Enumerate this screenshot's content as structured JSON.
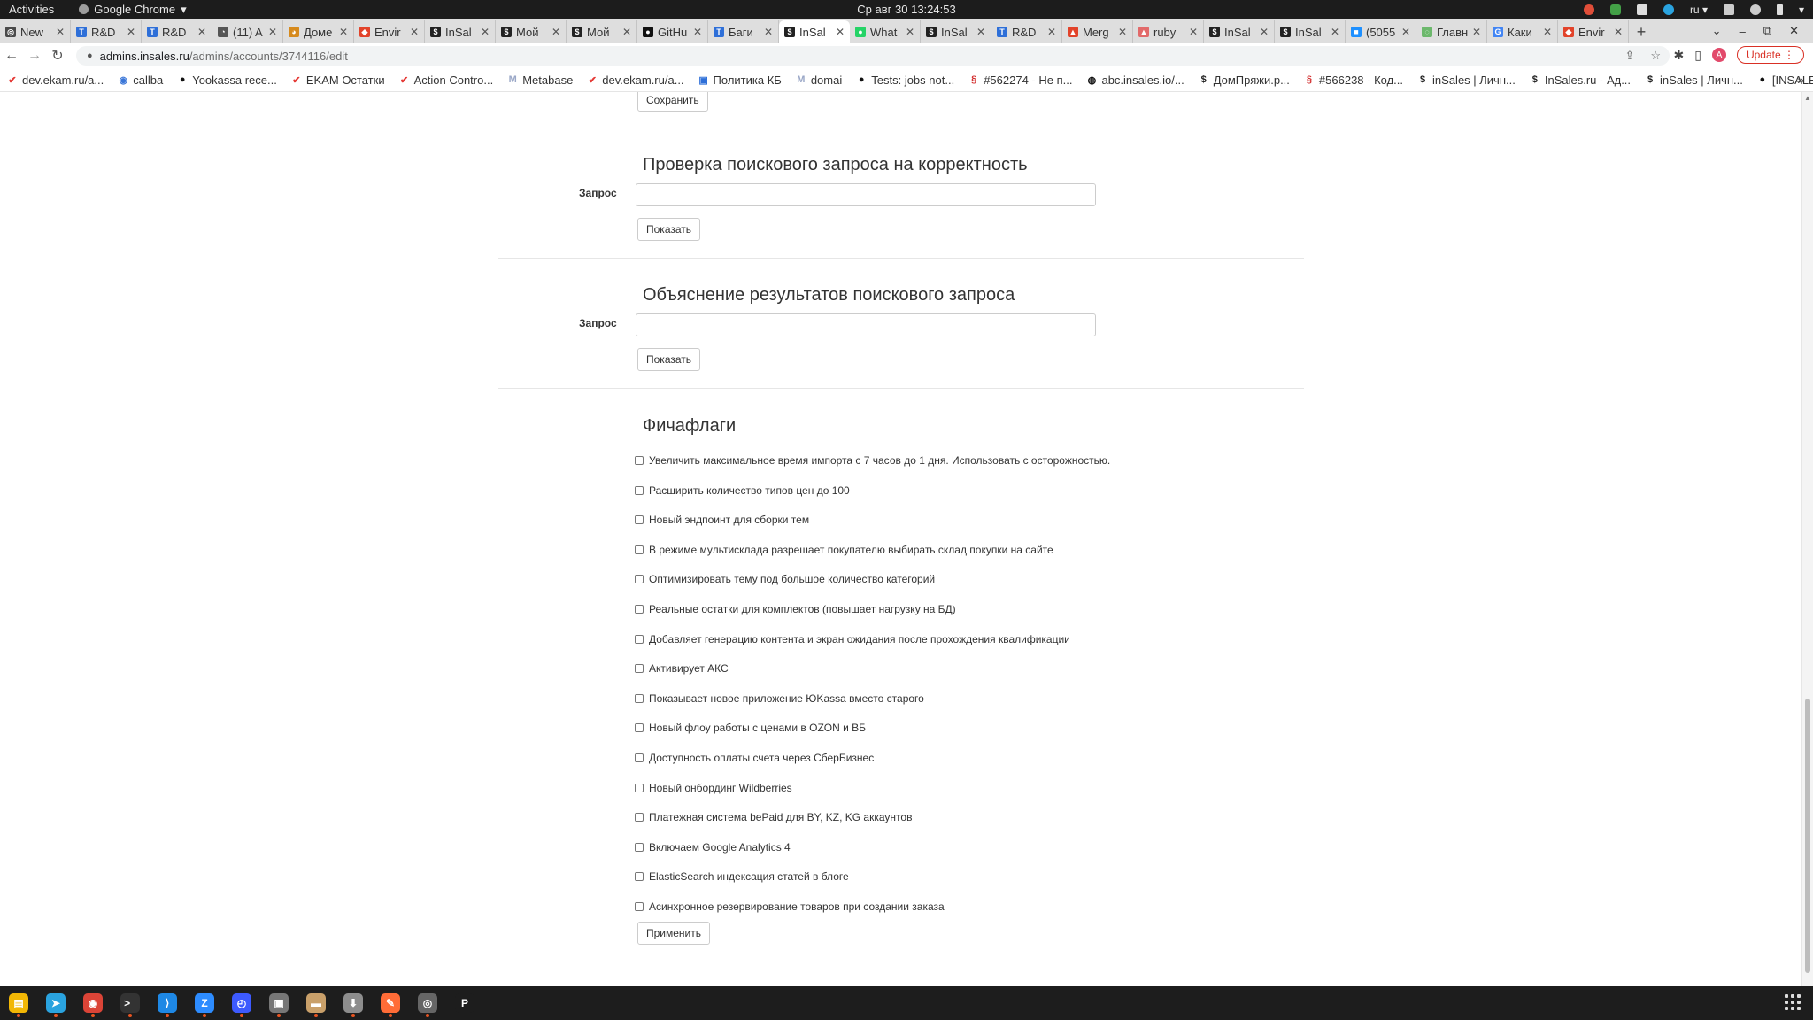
{
  "system": {
    "activities": "Activities",
    "app_name": "Google Chrome",
    "app_menu_arrow": "▾",
    "clock": "Ср авг 30  13:24:53",
    "lang": "ru ▾"
  },
  "tabs": [
    {
      "title": "New",
      "color": "#4a4a4a",
      "glyph": "◎"
    },
    {
      "title": "R&D",
      "color": "#2e6fd8",
      "glyph": "T"
    },
    {
      "title": "R&D",
      "color": "#2e6fd8",
      "glyph": "T"
    },
    {
      "title": "(11) A",
      "color": "#555555",
      "glyph": "◔"
    },
    {
      "title": "Доме",
      "color": "#d68a1d",
      "glyph": "◕"
    },
    {
      "title": "Envir",
      "color": "#e2432a",
      "glyph": "◆"
    },
    {
      "title": "InSal",
      "color": "#222222",
      "glyph": "$"
    },
    {
      "title": "Мой",
      "color": "#222222",
      "glyph": "$"
    },
    {
      "title": "Мой",
      "color": "#222222",
      "glyph": "$"
    },
    {
      "title": "GitHu",
      "color": "#111111",
      "glyph": "●"
    },
    {
      "title": "Баги",
      "color": "#2e6fd8",
      "glyph": "T"
    },
    {
      "title": "InSal",
      "color": "#222222",
      "glyph": "$",
      "active": true
    },
    {
      "title": "What",
      "color": "#25d366",
      "glyph": "●"
    },
    {
      "title": "InSal",
      "color": "#222222",
      "glyph": "$"
    },
    {
      "title": "R&D",
      "color": "#2e6fd8",
      "glyph": "T"
    },
    {
      "title": "Merg",
      "color": "#e2432a",
      "glyph": "▲"
    },
    {
      "title": "ruby",
      "color": "#e26a6a",
      "glyph": "▲"
    },
    {
      "title": "InSal",
      "color": "#222222",
      "glyph": "$"
    },
    {
      "title": "InSal",
      "color": "#222222",
      "glyph": "$"
    },
    {
      "title": "(5055",
      "color": "#1e90ff",
      "glyph": "■"
    },
    {
      "title": "Главн",
      "color": "#6cb86c",
      "glyph": "◌"
    },
    {
      "title": "Каки",
      "color": "#4285f4",
      "glyph": "G"
    },
    {
      "title": "Envir",
      "color": "#e2432a",
      "glyph": "◆"
    }
  ],
  "tab_close": "✕",
  "new_tab": "+",
  "tabstrip_controls": {
    "list": "⌄",
    "minimize": "–",
    "restore": "⧉",
    "close": "✕"
  },
  "toolbar": {
    "back": "←",
    "forward": "→",
    "reload": "↻",
    "lock": "🔒",
    "url_domain": "admins.insales.ru",
    "url_path": "/admins/accounts/3744116/edit",
    "share": "⇪",
    "star": "☆",
    "extensions": "✱",
    "sidepanel": "▯",
    "profile": "A",
    "update": "Update",
    "menu": "⋮"
  },
  "bookmarks": [
    {
      "label": "dev.ekam.ru/a...",
      "glyph": "✔",
      "color": "#e53935"
    },
    {
      "label": "callba",
      "glyph": "◉",
      "color": "#3a76d8"
    },
    {
      "label": "Yookassa rece...",
      "glyph": "●",
      "color": "#111111"
    },
    {
      "label": "EKAM Остатки",
      "glyph": "✔",
      "color": "#e53935"
    },
    {
      "label": "Action Contro...",
      "glyph": "✔",
      "color": "#e53935"
    },
    {
      "label": "Metabase",
      "glyph": "M",
      "color": "#9aa7c7"
    },
    {
      "label": "dev.ekam.ru/a...",
      "glyph": "✔",
      "color": "#e53935"
    },
    {
      "label": "Политика КБ",
      "glyph": "▣",
      "color": "#2e6fd8"
    },
    {
      "label": "domai",
      "glyph": "M",
      "color": "#9aa7c7"
    },
    {
      "label": "Tests: jobs not...",
      "glyph": "●",
      "color": "#111111"
    },
    {
      "label": "#562274 - Не п...",
      "glyph": "§",
      "color": "#d32f2f"
    },
    {
      "label": "abc.insales.io/...",
      "glyph": "◍",
      "color": "#111111"
    },
    {
      "label": "ДомПряжи.р...",
      "glyph": "$",
      "color": "#222222"
    },
    {
      "label": "#566238 - Код...",
      "glyph": "§",
      "color": "#d32f2f"
    },
    {
      "label": "inSales | Личн...",
      "glyph": "$",
      "color": "#222222"
    },
    {
      "label": "InSales.ru - Ад...",
      "glyph": "$",
      "color": "#222222"
    },
    {
      "label": "inSales | Личн...",
      "glyph": "$",
      "color": "#222222"
    },
    {
      "label": "[INSALESLIGH...",
      "glyph": "●",
      "color": "#111111"
    }
  ],
  "bookmarks_more": "»",
  "page": {
    "save_button": "Сохранить",
    "search_check": {
      "title": "Проверка поискового запроса на корректность",
      "label": "Запрос",
      "value": "",
      "button": "Показать"
    },
    "search_explain": {
      "title": "Объяснение результатов поискового запроса",
      "label": "Запрос",
      "value": "",
      "button": "Показать"
    },
    "feature_flags": {
      "title": "Фичафлаги",
      "apply_button": "Применить",
      "flags": [
        {
          "label": "Увеличить максимальное время импорта с 7 часов до 1 дня. Использовать с осторожностью.",
          "checked": false
        },
        {
          "label": "Расширить количество типов цен до 100",
          "checked": false
        },
        {
          "label": "Новый эндпоинт для сборки тем",
          "checked": false
        },
        {
          "label": "В режиме мультисклада разрешает покупателю выбирать склад покупки на сайте",
          "checked": false
        },
        {
          "label": "Оптимизировать тему под большое количество категорий",
          "checked": false
        },
        {
          "label": "Реальные остатки для комплектов (повышает нагрузку на БД)",
          "checked": false
        },
        {
          "label": "Добавляет генерацию контента и экран ожидания после прохождения квалификации",
          "checked": false
        },
        {
          "label": "Активирует АКС",
          "checked": false
        },
        {
          "label": "Показывает новое приложение ЮKassa вместо старого",
          "checked": false
        },
        {
          "label": "Новый флоу работы с ценами в OZON и ВБ",
          "checked": false
        },
        {
          "label": "Доступность оплаты счета через СберБизнес",
          "checked": false
        },
        {
          "label": "Новый онбординг Wildberries",
          "checked": false
        },
        {
          "label": "Платежная система bePaid для BY, KZ, KG аккаунтов",
          "checked": false
        },
        {
          "label": "Включаем Google Analytics 4",
          "checked": false
        },
        {
          "label": "ElasticSearch индексация статей в блоге",
          "checked": false
        },
        {
          "label": "Асинхронное резервирование товаров при создании заказа",
          "checked": false
        }
      ]
    }
  },
  "dock": [
    {
      "name": "files-yellow",
      "color": "#f2b705",
      "glyph": "▤",
      "running": true
    },
    {
      "name": "telegram",
      "color": "#2aa3df",
      "glyph": "➤",
      "running": true
    },
    {
      "name": "chrome",
      "color": "#db4437",
      "glyph": "◉",
      "running": true
    },
    {
      "name": "terminal",
      "color": "#333333",
      "glyph": ">_",
      "running": true
    },
    {
      "name": "vscode",
      "color": "#1e88e5",
      "glyph": "⟩",
      "running": true
    },
    {
      "name": "zoom",
      "color": "#2d8cff",
      "glyph": "Z",
      "running": true
    },
    {
      "name": "clock-app",
      "color": "#3d5afe",
      "glyph": "◴",
      "running": true
    },
    {
      "name": "screenshot",
      "color": "#777777",
      "glyph": "▣",
      "running": true
    },
    {
      "name": "folder",
      "color": "#c9a06a",
      "glyph": "▬",
      "running": true
    },
    {
      "name": "archive",
      "color": "#8d8d8d",
      "glyph": "⬇",
      "running": true
    },
    {
      "name": "postman",
      "color": "#ff6c37",
      "glyph": "✎",
      "running": true
    },
    {
      "name": "settings",
      "color": "#666666",
      "glyph": "◎",
      "running": true
    },
    {
      "name": "p-app",
      "color": "#1d1d1d",
      "glyph": "P",
      "running": false
    }
  ]
}
